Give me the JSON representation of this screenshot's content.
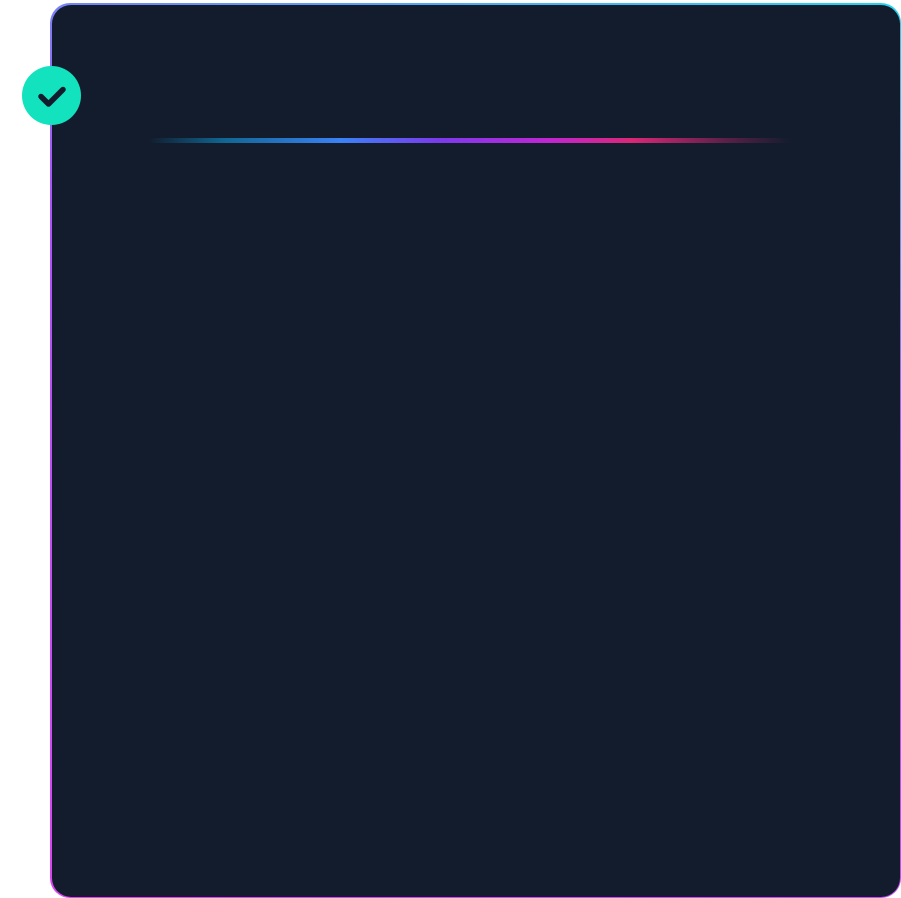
{
  "status": {
    "icon": "check-circle-icon",
    "state": "success"
  },
  "colors": {
    "page_background": "#ffffff",
    "card_background": "#121c2d",
    "badge": "#12e2bd",
    "checkmark": "#121c2d",
    "border_gradient": [
      "#22d3ee",
      "#a855f7",
      "#d946ef"
    ],
    "accent_gradient": [
      "#0ea5e9",
      "#3b82f6",
      "#7c3aed",
      "#c026d3",
      "#db2777"
    ]
  }
}
